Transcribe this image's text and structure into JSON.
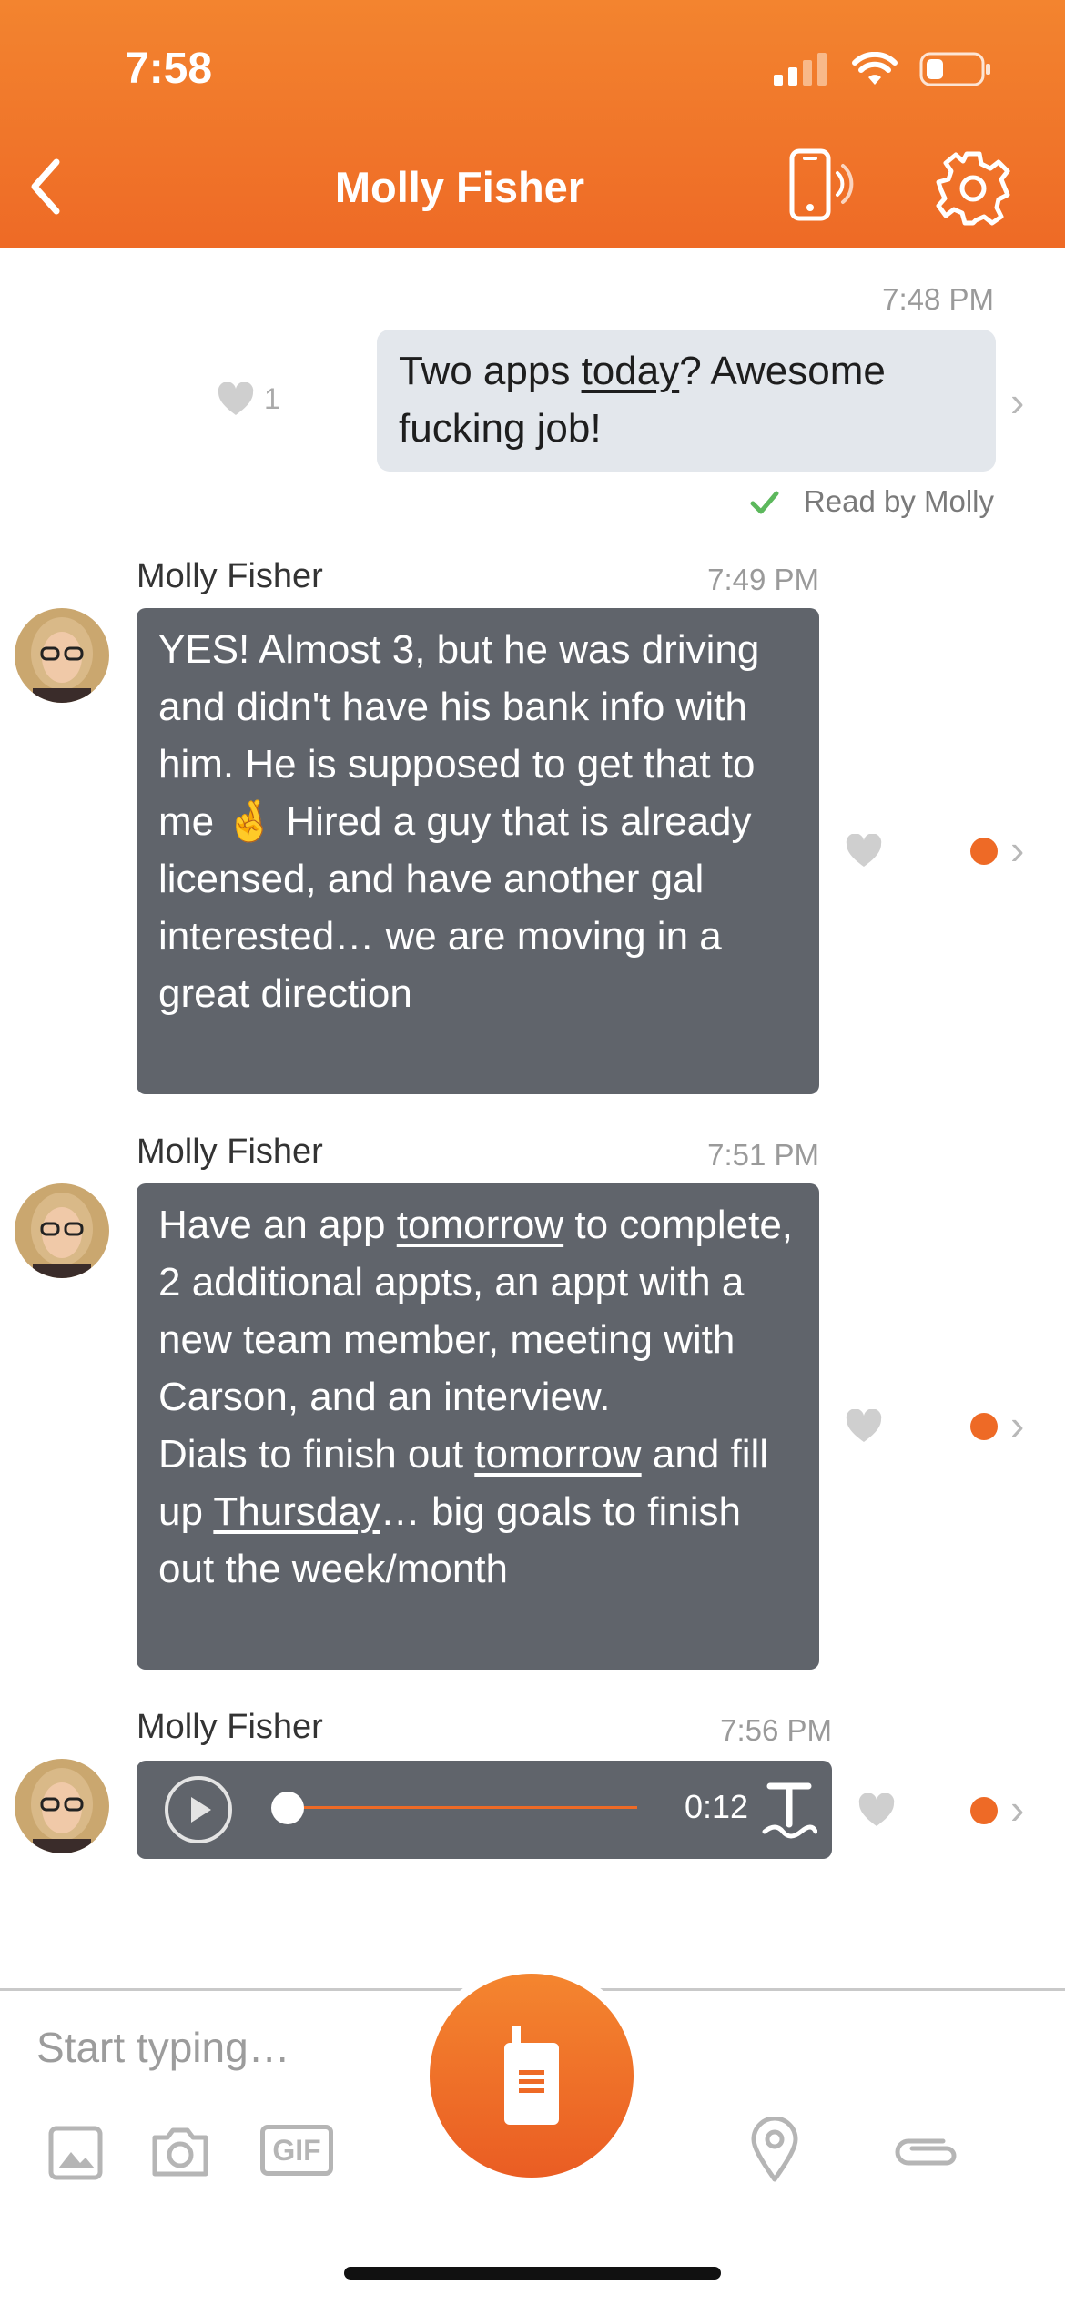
{
  "status_bar": {
    "time": "7:58"
  },
  "header": {
    "title": "Molly Fisher"
  },
  "messages": [
    {
      "type": "outgoing",
      "time": "7:48 PM",
      "parts": [
        "Two apps ",
        "today",
        "? Awesome fucking job!"
      ],
      "likes": "1",
      "read_receipt": "Read by Molly"
    },
    {
      "type": "incoming",
      "sender": "Molly Fisher",
      "time": "7:49 PM",
      "text": "YES! Almost 3, but he was driving and didn't have his bank info with him. He is supposed to get that to me 🤞 Hired a guy that is already licensed, and have another gal interested… we are moving in a great direction"
    },
    {
      "type": "incoming",
      "sender": "Molly Fisher",
      "time": "7:51 PM",
      "parts": [
        "Have an app ",
        "tomorrow",
        " to complete, 2 additional appts, an appt with a new team member, meeting with Carson, and an interview.",
        "Dials to finish out ",
        "tomorrow",
        " and fill up ",
        "Thursday",
        "… big goals to finish out the week/month"
      ]
    },
    {
      "type": "voice",
      "sender": "Molly Fisher",
      "time": "7:56 PM",
      "duration": "0:12",
      "progress": 0
    }
  ],
  "composer": {
    "placeholder": "Start typing…",
    "gif_label": "GIF"
  },
  "colors": {
    "brand": "#ee6a26",
    "incoming_bubble": "#60646b",
    "outgoing_bubble": "#e3e7ec",
    "read_check": "#5cb85c"
  }
}
